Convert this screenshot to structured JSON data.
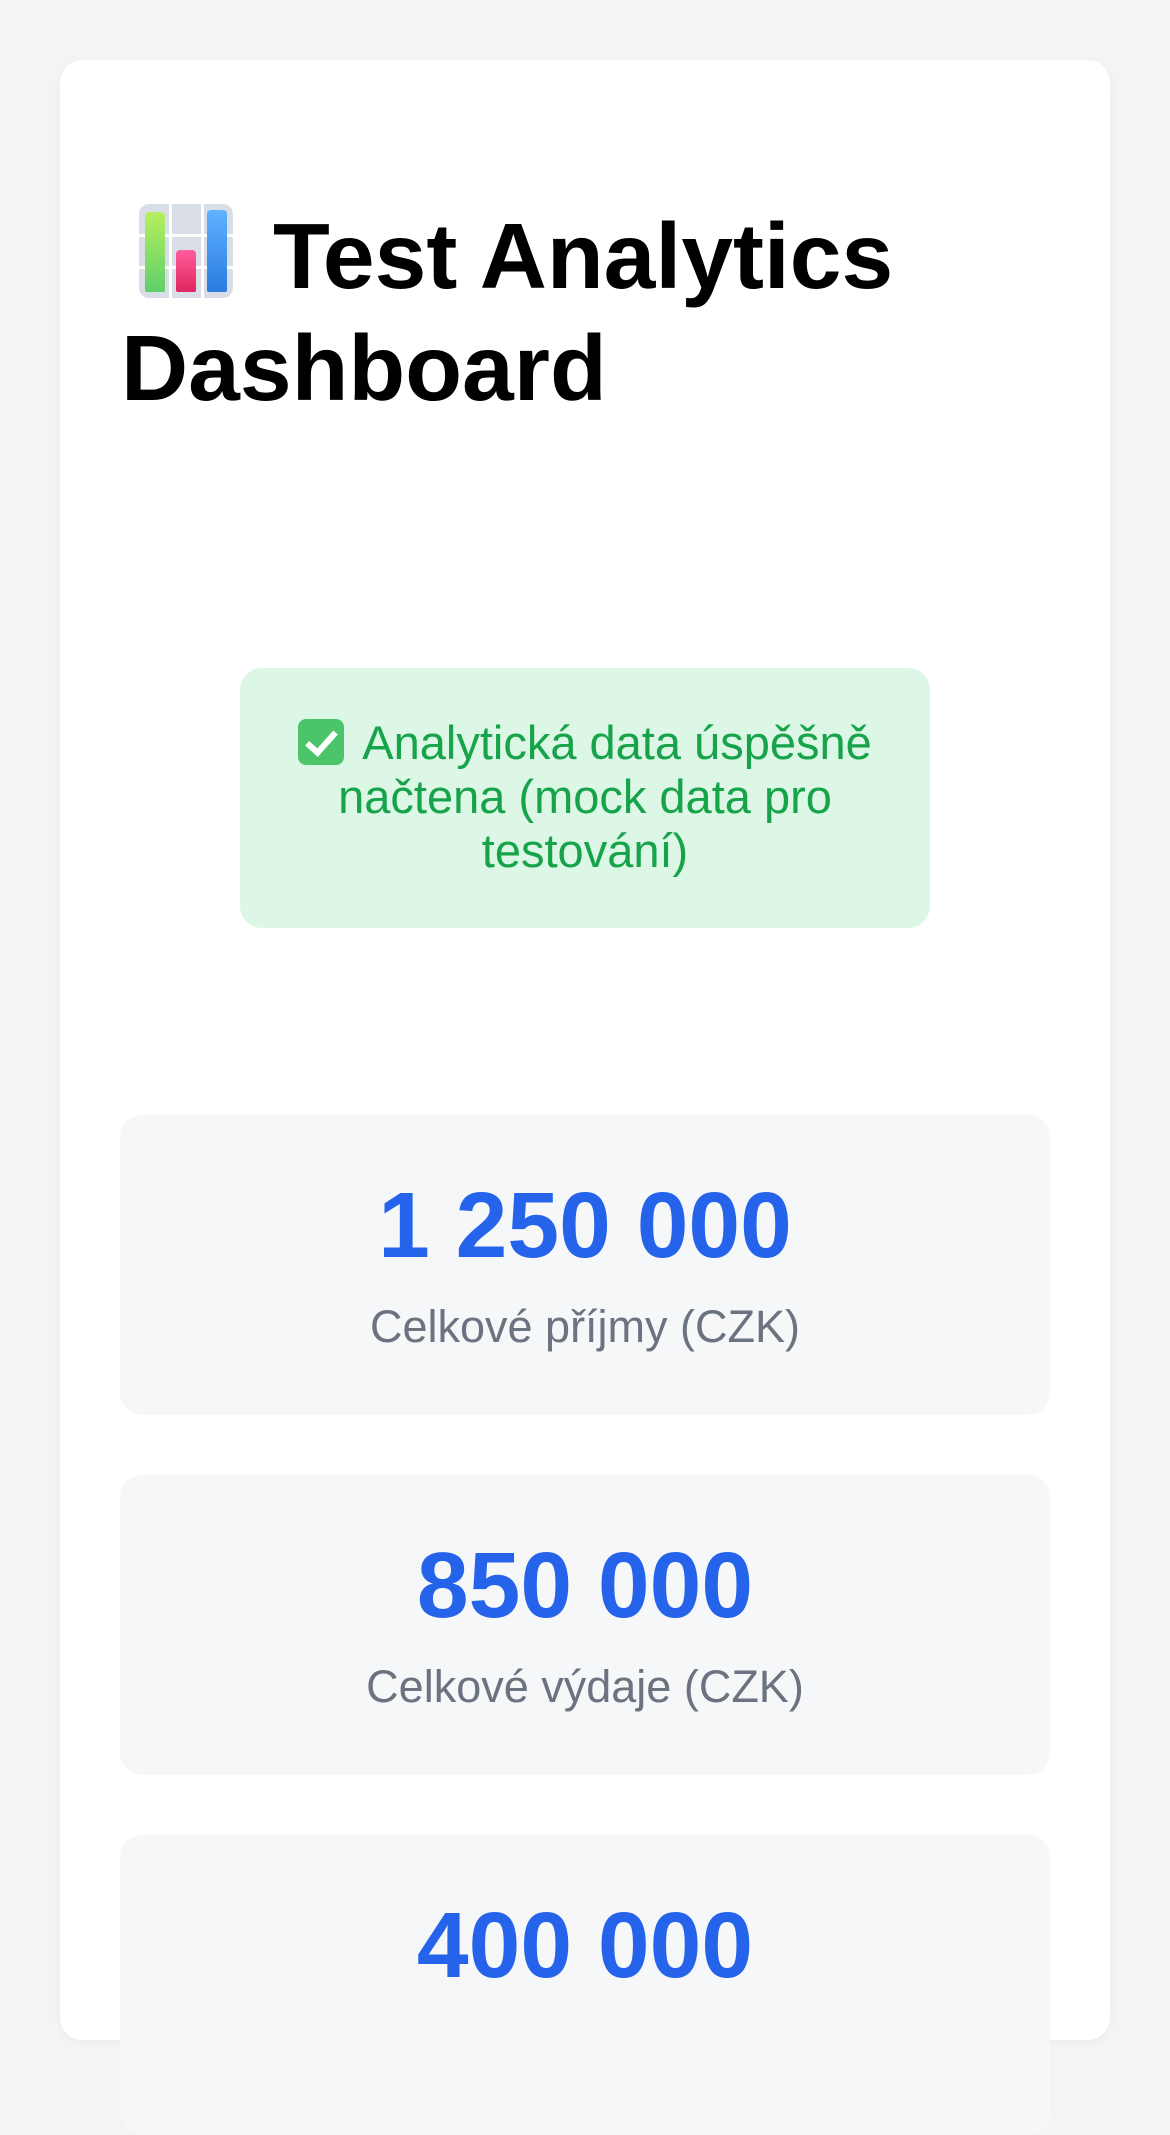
{
  "header": {
    "title": "Test Analytics Dashboard",
    "icon": "bar-chart-icon"
  },
  "status": {
    "icon": "check-mark-button-icon",
    "message": "Analytická data úspěšně načtena (mock data pro testování)",
    "color": "#16a34a",
    "background": "#dcf7e5"
  },
  "stats": [
    {
      "value": "1 250 000",
      "label": "Celkové příjmy (CZK)"
    },
    {
      "value": "850 000",
      "label": "Celkové výdaje (CZK)"
    },
    {
      "value": "400 000",
      "label": ""
    }
  ],
  "colors": {
    "accent": "#2563eb",
    "muted": "#6b7280",
    "page_background": "#f4f4f5",
    "card_background": "#ffffff"
  }
}
